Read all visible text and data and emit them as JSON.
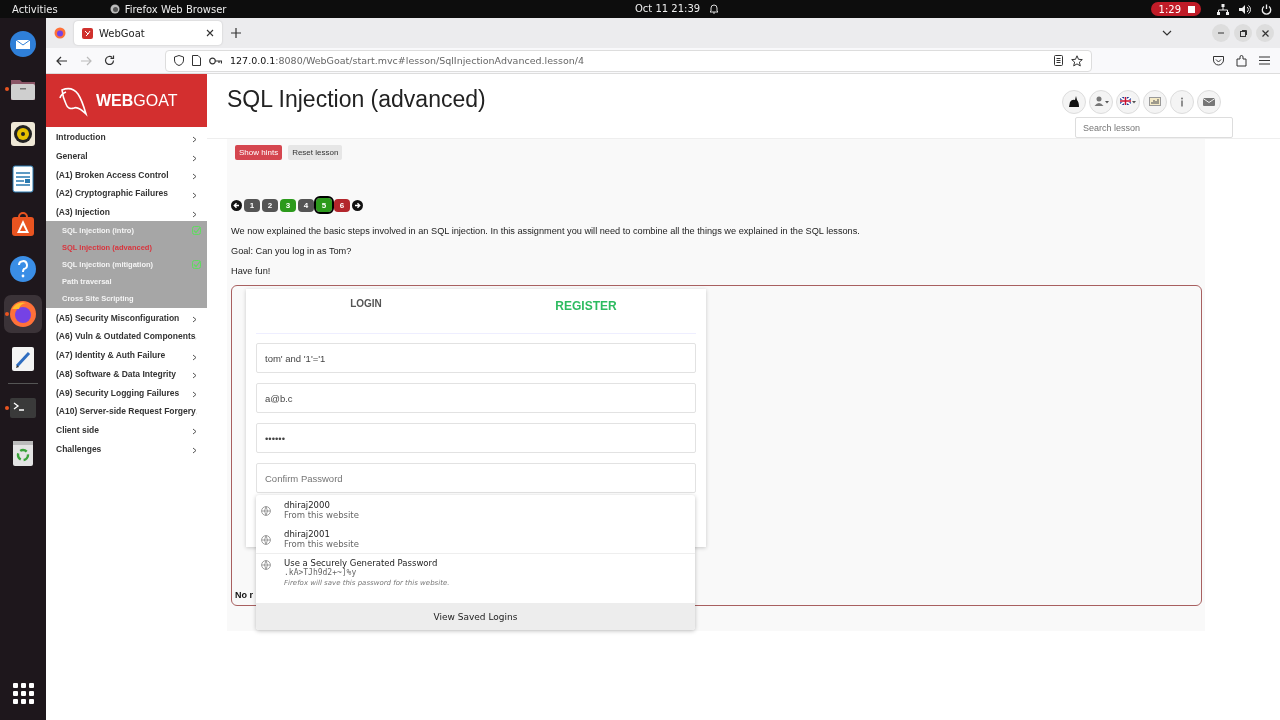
{
  "top_bar": {
    "activities": "Activities",
    "app_name": "Firefox Web Browser",
    "clock": "Oct 11  21:39",
    "recording_time": "1:29"
  },
  "dock": {
    "items": [
      {
        "kind": "mail",
        "running": false,
        "selected": false
      },
      {
        "kind": "files",
        "running": true,
        "selected": false
      },
      {
        "kind": "music",
        "running": false,
        "selected": false
      },
      {
        "kind": "writer",
        "running": false,
        "selected": false
      },
      {
        "kind": "software",
        "running": false,
        "selected": false
      },
      {
        "kind": "help",
        "running": false,
        "selected": false
      },
      {
        "kind": "firefox",
        "running": true,
        "selected": true
      },
      {
        "kind": "editor",
        "running": false,
        "selected": false
      },
      {
        "kind": "terminal",
        "running": true,
        "selected": false
      },
      {
        "kind": "trash",
        "running": false,
        "selected": false
      }
    ]
  },
  "browser": {
    "tabs": [
      {
        "title": "WebGoat",
        "selected": true
      }
    ],
    "url_host": "127.0.0.1",
    "url_path": ":8080/WebGoat/start.mvc#lesson/SqlInjectionAdvanced.lesson/4"
  },
  "sidebar": {
    "logo": "**WEB**GOAT",
    "categories": [
      {
        "label": "Introduction"
      },
      {
        "label": "General"
      },
      {
        "label": "(A1) Broken Access Control"
      },
      {
        "label": "(A2) Cryptographic Failures"
      },
      {
        "label": "(A3) Injection",
        "children": [
          {
            "label": "SQL Injection (intro)",
            "completed": true,
            "selected": false
          },
          {
            "label": "SQL Injection (advanced)",
            "completed": false,
            "selected": true
          },
          {
            "label": "SQL Injection (mitigation)",
            "completed": true,
            "selected": false
          },
          {
            "label": "Path traversal",
            "completed": false,
            "selected": false
          },
          {
            "label": "Cross Site Scripting",
            "completed": false,
            "selected": false
          }
        ]
      },
      {
        "label": "(A5) Security Misconfiguration"
      },
      {
        "label": "(A6) Vuln & Outdated Components"
      },
      {
        "label": "(A7) Identity & Auth Failure"
      },
      {
        "label": "(A8) Software & Data Integrity"
      },
      {
        "label": "(A9) Security Logging Failures"
      },
      {
        "label": "(A10) Server-side Request Forgery"
      },
      {
        "label": "Client side"
      },
      {
        "label": "Challenges"
      }
    ]
  },
  "header": {
    "title": "SQL Injection (advanced)",
    "search": {
      "placeholder": "Search lesson"
    }
  },
  "lesson_buttons": [
    {
      "label": "Show hints",
      "kind": "danger"
    },
    {
      "label": "Reset lesson",
      "kind": "default"
    }
  ],
  "pages": [
    {
      "label": "1",
      "color": "#555555",
      "selected": false
    },
    {
      "label": "2",
      "color": "#555555",
      "selected": false
    },
    {
      "label": "3",
      "color": "#2c9a1c",
      "selected": false
    },
    {
      "label": "4",
      "color": "#555555",
      "selected": false
    },
    {
      "label": "5",
      "color": "#2c9a1c",
      "selected": true
    },
    {
      "label": "6",
      "color": "#b3262c",
      "selected": false
    }
  ],
  "paragraphs": [
    "We now explained the basic steps involved in an SQL injection. In this assignment you will need to combine all the things we explained in the SQL lessons.",
    "Goal: Can you log in as Tom?",
    "Have fun!"
  ],
  "form": {
    "tabs": [
      {
        "label": "LOGIN",
        "selected": false
      },
      {
        "label": "REGISTER",
        "selected": true
      }
    ],
    "fields": [
      {
        "value": "tom' and '1'='1"
      },
      {
        "value": "a@b.c"
      },
      {
        "value": "••••••"
      },
      {
        "placeholder": "Confirm Password"
      }
    ]
  },
  "result": "No r",
  "autocomplete": {
    "logins": [
      {
        "username": "dhiraj2000",
        "source": "From this website"
      },
      {
        "username": "dhiraj2001",
        "source": "From this website"
      }
    ],
    "generated": {
      "title": "Use a Securely Generated Password",
      "password": ".kA>TJh9d2+~]%y",
      "note": "Firefox will save this password for this website."
    },
    "footer": "View Saved Logins"
  }
}
